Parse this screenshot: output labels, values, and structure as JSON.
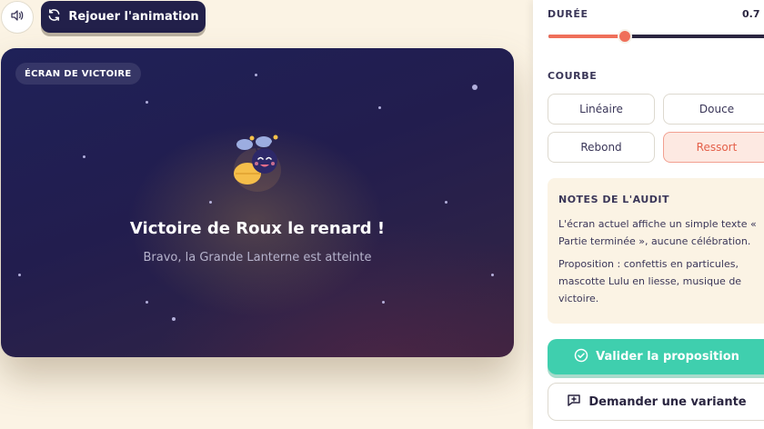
{
  "toolbar": {
    "sound_icon": "speaker-icon",
    "replay_icon": "refresh-icon",
    "replay_label": "Rejouer l'animation"
  },
  "stage": {
    "badge": "ÉCRAN DE VICTOIRE",
    "title": "Victoire de Roux le renard !",
    "subtitle": "Bravo, la Grande Lanterne est atteinte",
    "mascot_icon": "firefly-mascot-icon"
  },
  "panel": {
    "duration": {
      "label": "DURÉE",
      "value": "0.7",
      "fraction": 0.35
    },
    "curve": {
      "label": "COURBE",
      "options": [
        "Linéaire",
        "Douce",
        "Rebond",
        "Ressort"
      ],
      "selected": "Ressort"
    },
    "notes": {
      "title": "NOTES DE L'AUDIT",
      "paragraphs": [
        "L'écran actuel affiche un simple texte « Partie terminée », aucune célébration.",
        "Proposition : confettis en particules, mascotte Lulu en liesse, musique de victoire."
      ]
    },
    "validate_label": "Valider la proposition",
    "validate_icon": "check-circle-icon",
    "variant_label": "Demander une variante",
    "variant_icon": "comment-plus-icon"
  },
  "colors": {
    "accent": "#ef6f5a",
    "success": "#3fcfae",
    "dark": "#22204a",
    "background": "#fbf3e4"
  }
}
